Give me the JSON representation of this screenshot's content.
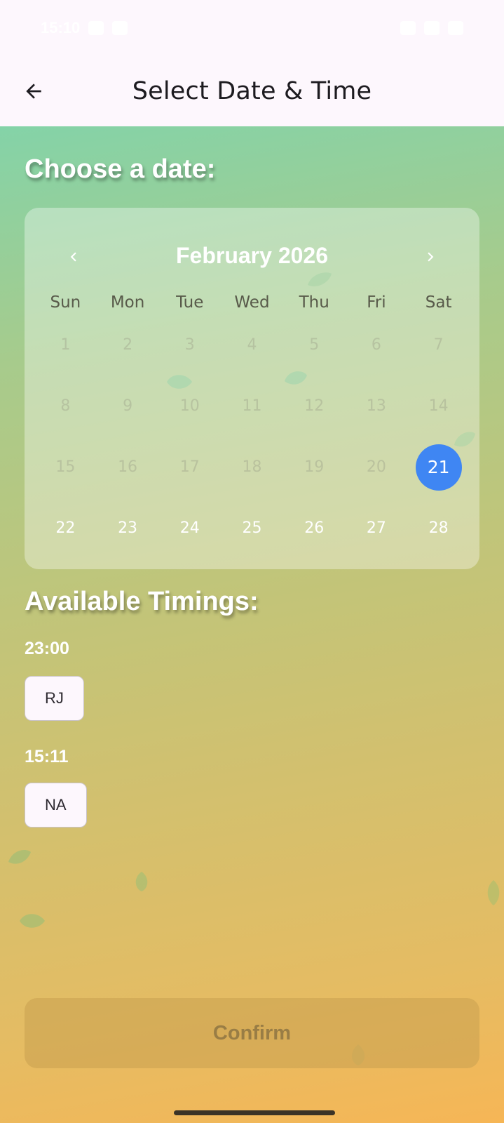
{
  "status_bar": {
    "time": "15:10"
  },
  "app_bar": {
    "title": "Select Date & Time"
  },
  "date_section": {
    "heading": "Choose a date:"
  },
  "calendar": {
    "month_label": "February 2026",
    "weekdays": [
      "Sun",
      "Mon",
      "Tue",
      "Wed",
      "Thu",
      "Fri",
      "Sat"
    ],
    "days": [
      "1",
      "2",
      "3",
      "4",
      "5",
      "6",
      "7",
      "8",
      "9",
      "10",
      "11",
      "12",
      "13",
      "14",
      "15",
      "16",
      "17",
      "18",
      "19",
      "20",
      "21",
      "22",
      "23",
      "24",
      "25",
      "26",
      "27",
      "28"
    ],
    "selected_day": "21",
    "enabled_days": [
      "21",
      "22",
      "23",
      "24",
      "25",
      "26",
      "27",
      "28"
    ],
    "selected_color": "#3f86f3"
  },
  "timings_section": {
    "heading": "Available Timings:",
    "slots": [
      {
        "time": "23:00",
        "chip": "RJ"
      },
      {
        "time": "15:11",
        "chip": "NA"
      }
    ]
  },
  "confirm": {
    "label": "Confirm"
  }
}
